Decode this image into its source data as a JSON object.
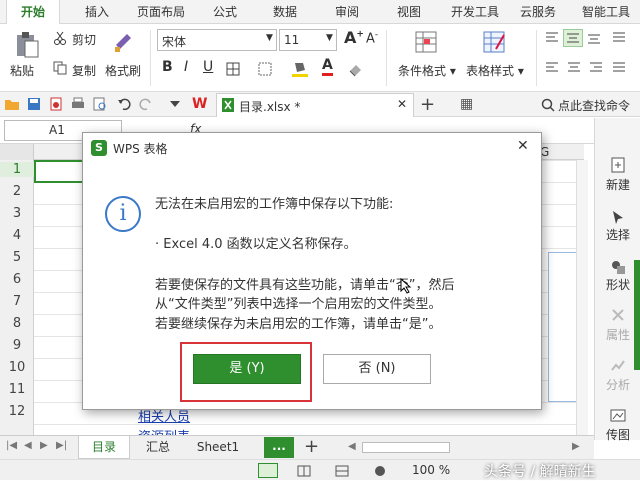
{
  "ribbon_tabs": [
    "开始",
    "插入",
    "页面布局",
    "公式",
    "数据",
    "审阅",
    "视图",
    "开发工具",
    "云服务",
    "智能工具"
  ],
  "ribbon": {
    "paste": "粘贴",
    "cut": "剪切",
    "copy": "复制",
    "format_painter": "格式刷",
    "font_name": "宋体",
    "font_size": "11",
    "bold": "B",
    "italic": "I",
    "underline": "U",
    "grow_font": "A",
    "shrink_font": "A",
    "font_color_letter": "A",
    "cond_format": "条件格式",
    "table_style": "表格样式"
  },
  "quickbar": {
    "wps_logo": "W",
    "doc_tab": "目录.xlsx *",
    "search_cmd": "点此查找命令"
  },
  "formula_bar": {
    "name_box": "A1",
    "fx": "fx"
  },
  "columns": {
    "g": "G"
  },
  "rows": [
    "1",
    "2",
    "3",
    "4",
    "5",
    "6",
    "7",
    "8",
    "9",
    "10",
    "11",
    "12"
  ],
  "cells": {
    "row12": "相关人员",
    "row13": "资源列表"
  },
  "side_panel": [
    "新建",
    "选择",
    "形状",
    "属性",
    "分析",
    "传图"
  ],
  "sheets": [
    "目录",
    "汇总",
    "Sheet1"
  ],
  "sheet_more": "...",
  "status": {
    "zoom": "100 %",
    "watermark": "头条号 / 解晴新生"
  },
  "dialog": {
    "title": "WPS 表格",
    "info_icon": "i",
    "line1": "无法在未启用宏的工作簿中保存以下功能:",
    "line2": "· Excel 4.0 函数以定义名称保存。",
    "line3": "若要使保存的文件具有这些功能，请单击“否”，然后",
    "line4": "从“文件类型”列表中选择一个启用宏的文件类型。",
    "line5": "若要继续保存为未启用宏的工作簿，请单击“是”。",
    "yes": "是 (Y)",
    "no": "否 (N)",
    "close": "✕"
  },
  "colors": {
    "accent": "#2f8f2f",
    "highlight_border": "#d9333a",
    "tab_active": "#2d7d2d"
  }
}
